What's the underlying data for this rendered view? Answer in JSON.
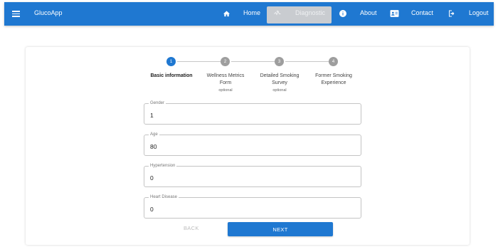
{
  "appbar": {
    "brand": "GlucoApp",
    "nav": {
      "home": "Home",
      "diagnostic": "Diagnostic",
      "about": "About",
      "contact": "Contact",
      "logout": "Logout"
    }
  },
  "stepper": {
    "steps": [
      {
        "number": "1",
        "label": "Basic information",
        "optional": ""
      },
      {
        "number": "2",
        "label": "Wellness Metrics Form",
        "optional": "optional"
      },
      {
        "number": "3",
        "label": "Detailed Smoking Survey",
        "optional": "optional"
      },
      {
        "number": "4",
        "label": "Former Smoking Experience",
        "optional": ""
      }
    ]
  },
  "form": {
    "fields": [
      {
        "label": "Gender",
        "value": "1"
      },
      {
        "label": "Age",
        "value": "80"
      },
      {
        "label": "Hypertension",
        "value": "0"
      },
      {
        "label": "Heart Disease",
        "value": "0"
      }
    ]
  },
  "actions": {
    "back": "BACK",
    "next": "NEXT"
  },
  "colors": {
    "primary": "#1f78d1",
    "inactive_step": "#9e9e9e",
    "diagnostic_highlight": "#c9ccd0"
  }
}
